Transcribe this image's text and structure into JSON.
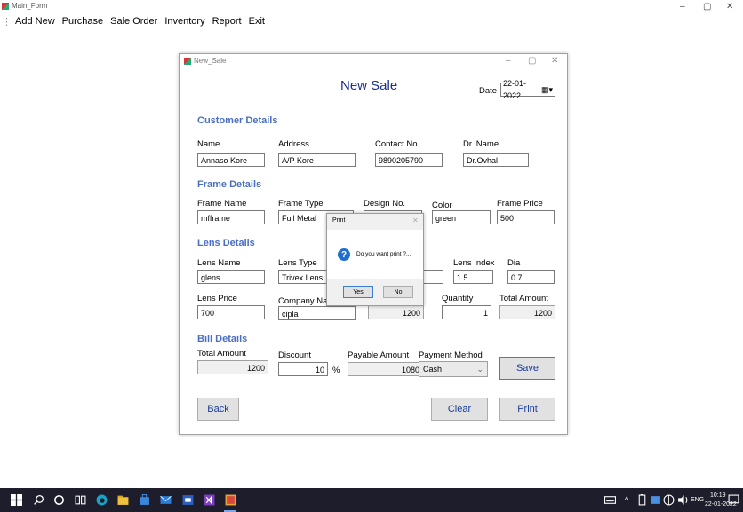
{
  "main_window": {
    "title": "Main_Form",
    "controls": {
      "minimize": "–",
      "maximize": "▢",
      "close": "✕"
    },
    "menu": [
      "Add New",
      "Purchase",
      "Sale Order",
      "Inventory",
      "Report",
      "Exit"
    ]
  },
  "sale_window": {
    "title": "New_Sale",
    "controls": {
      "minimize": "–",
      "maximize": "▢",
      "close": "✕"
    },
    "heading": "New Sale",
    "date_label": "Date",
    "date_value": "22-01-2022",
    "customer": {
      "section": "Customer Details",
      "name_label": "Name",
      "name": "Annaso Kore",
      "address_label": "Address",
      "address": "A/P Kore",
      "contact_label": "Contact No.",
      "contact": "9890205790",
      "doctor_label": "Dr. Name",
      "doctor": "Dr.Ovhal"
    },
    "frame": {
      "section": "Frame Details",
      "name_label": "Frame Name",
      "name": "mfframe",
      "type_label": "Frame Type",
      "type": "Full Metal",
      "design_label": "Design No.",
      "design": "",
      "color_label": "Color",
      "color": "green",
      "price_label": "Frame Price",
      "price": "500"
    },
    "lens": {
      "section": "Lens Details",
      "name_label": "Lens Name",
      "name": "glens",
      "type_label": "Lens Type",
      "type": "Trivex Lens",
      "index_label": "Lens Index",
      "index": "1.5",
      "dia_label": "Dia",
      "dia": "0.7",
      "price_label": "Lens Price",
      "price": "700",
      "company_label": "Company Name",
      "company": "cipla",
      "subtotal": "1200",
      "quantity_label": "Quantity",
      "quantity": "1",
      "total_label": "Total Amount",
      "total": "1200"
    },
    "bill": {
      "section": "Bill Details",
      "total_label": "Total Amount",
      "total": "1200",
      "discount_label": "Discount",
      "discount": "10",
      "percent": "%",
      "payable_label": "Payable Amount",
      "payable": "1080",
      "payment_label": "Payment Method",
      "payment": "Cash"
    },
    "buttons": {
      "save": "Save",
      "back": "Back",
      "clear": "Clear",
      "print": "Print"
    }
  },
  "print_dialog": {
    "title": "Print",
    "message": "Do you want print ?...",
    "yes": "Yes",
    "no": "No"
  },
  "taskbar": {
    "language": "ENG",
    "time": "10:19",
    "date": "22-01-2022"
  }
}
